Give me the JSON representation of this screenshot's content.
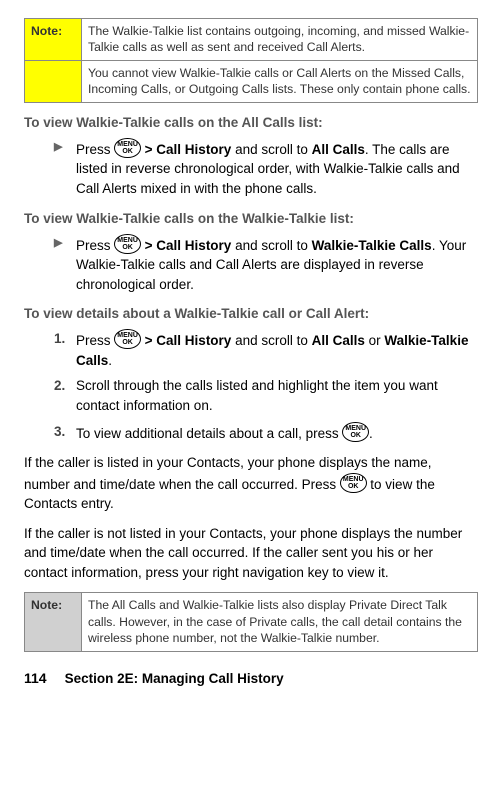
{
  "note1": {
    "label": "Note:",
    "para1": "The Walkie-Talkie list contains outgoing, incoming, and missed Walkie-Talkie calls as well as sent and received Call Alerts.",
    "para2": "You cannot view Walkie-Talkie calls or Call Alerts on the Missed Calls, Incoming Calls, or Outgoing Calls lists. These only contain phone calls."
  },
  "h1": "To view Walkie-Talkie calls on the All Calls list:",
  "step_h1": {
    "pre": "Press ",
    "after_ok": " > ",
    "ch": "Call History",
    "mid": " and scroll to ",
    "allcalls": "All Calls",
    "tail": ". The calls are listed in reverse chronological order, with Walkie-Talkie calls and Call Alerts mixed in with the phone calls."
  },
  "h2": "To view Walkie-Talkie calls on the Walkie-Talkie list:",
  "step_h2": {
    "pre": "Press ",
    "after_ok": " > ",
    "ch": "Call History",
    "mid": " and scroll to ",
    "wt": "Walkie-Talkie Calls",
    "tail": ". Your Walkie-Talkie calls and Call Alerts are displayed in reverse chronological order."
  },
  "h3": "To view details about a Walkie-Talkie call or Call Alert:",
  "steps3": {
    "m1": "1.",
    "s1": {
      "pre": "Press ",
      "after_ok": " > ",
      "ch": "Call History",
      "mid": " and scroll to ",
      "allcalls": "All Calls",
      "or": " or ",
      "wt": "Walkie-Talkie Calls",
      "tail": "."
    },
    "m2": "2.",
    "s2": "Scroll through the calls listed and highlight the item you want contact information on.",
    "m3": "3.",
    "s3_pre": "To view additional details about a call, press ",
    "s3_tail": "."
  },
  "para1": {
    "a": "If the caller is listed in your Contacts, your phone displays the name, number and time/date when the call occurred. Press ",
    "b": " to view the Contacts entry."
  },
  "para2": "If the caller is not listed in your Contacts, your phone displays the number and time/date when the call occurred. If the caller sent you his or her contact information, press your right navigation key to view it.",
  "note2": {
    "label": "Note:",
    "para": "The All Calls and Walkie-Talkie lists also display Private Direct Talk calls. However, in the case of Private calls, the call detail contains the wireless phone number, not the Walkie-Talkie number."
  },
  "footer": {
    "page": "114",
    "section": "Section 2E: Managing Call History"
  },
  "ok_label": "MENU\nOK"
}
